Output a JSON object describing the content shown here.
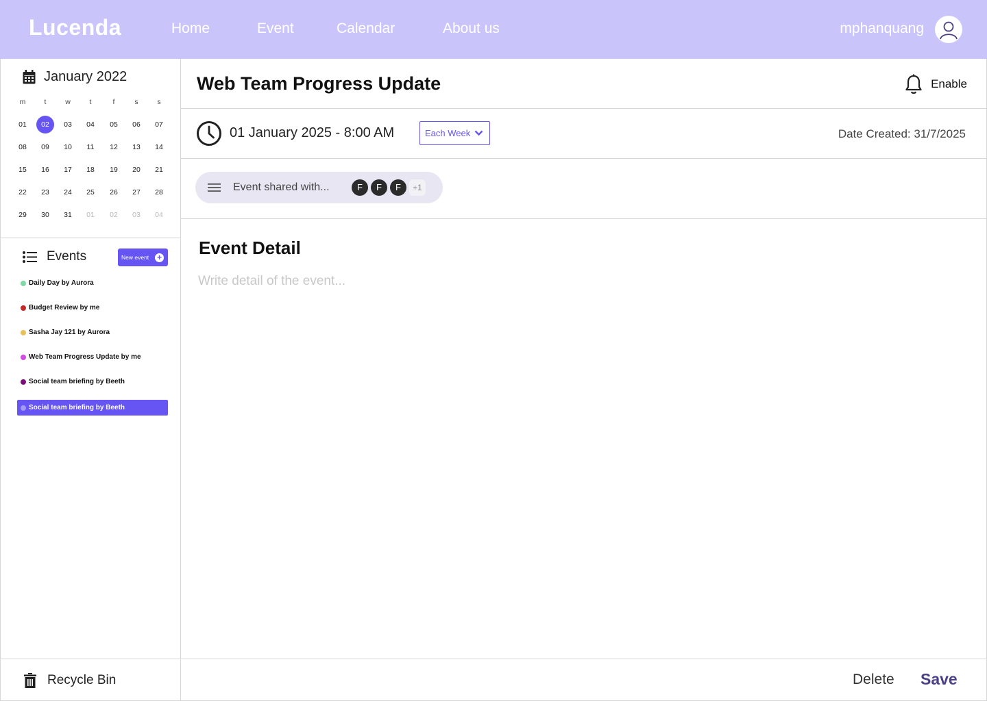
{
  "brand": {
    "logo_text": "Lucenda",
    "accent": "#6655f2",
    "header_bg": "#c9c5fb"
  },
  "nav": {
    "items": [
      {
        "label": "Home"
      },
      {
        "label": "Event"
      },
      {
        "label": "Calendar"
      },
      {
        "label": "About us"
      }
    ],
    "username": "mphanquang",
    "avatar_icon": "user-icon"
  },
  "calendar": {
    "icon": "calendar-icon",
    "title": "January 2022",
    "weekdays": [
      "m",
      "t",
      "w",
      "t",
      "f",
      "s",
      "s"
    ],
    "weeks": [
      [
        "01",
        "02",
        "03",
        "04",
        "05",
        "06",
        "07"
      ],
      [
        "08",
        "09",
        "10",
        "11",
        "12",
        "13",
        "14"
      ],
      [
        "15",
        "16",
        "17",
        "18",
        "19",
        "20",
        "21"
      ],
      [
        "22",
        "23",
        "24",
        "25",
        "26",
        "27",
        "28"
      ],
      [
        "29",
        "30",
        "31",
        "01",
        "02",
        "03",
        "04"
      ]
    ],
    "selected_day": "02",
    "next_month_days": [
      "01",
      "02",
      "03",
      "04"
    ]
  },
  "events_panel": {
    "icon": "list-icon",
    "title": "Events",
    "new_event_label": "New event",
    "items": [
      {
        "label": "Daily Day by Aurora",
        "color": "#7fd9a4"
      },
      {
        "label": "Budget Review by me",
        "color": "#c62828"
      },
      {
        "label": "Sasha Jay 121 by Aurora",
        "color": "#e8c15a"
      },
      {
        "label": "Web Team Progress Update by me",
        "color": "#d24be3"
      },
      {
        "label": "Social team briefing by Beeth",
        "color": "#7a0f7a"
      },
      {
        "label": "Social team briefing by Beeth",
        "color": "#a39af5",
        "active": true
      }
    ]
  },
  "recycle_bin": {
    "label": "Recycle Bin",
    "icon": "trash-icon"
  },
  "event": {
    "title": "Web Team Progress Update",
    "notification_label": "Enable",
    "notification_icon": "bell-icon",
    "datetime": "01 January 2025 - 8:00 AM",
    "clock_icon": "clock-icon",
    "repeat_label": "Each Week",
    "date_created": "Date Created: 31/7/2025",
    "shared_label": "Event shared with...",
    "shared_icon": "menu-icon",
    "shared_avatars": [
      "F",
      "F",
      "F"
    ],
    "shared_more": "+1",
    "detail_title": "Event Detail",
    "detail_placeholder": "Write detail of the event..."
  },
  "footer": {
    "delete_label": "Delete",
    "save_label": "Save"
  }
}
